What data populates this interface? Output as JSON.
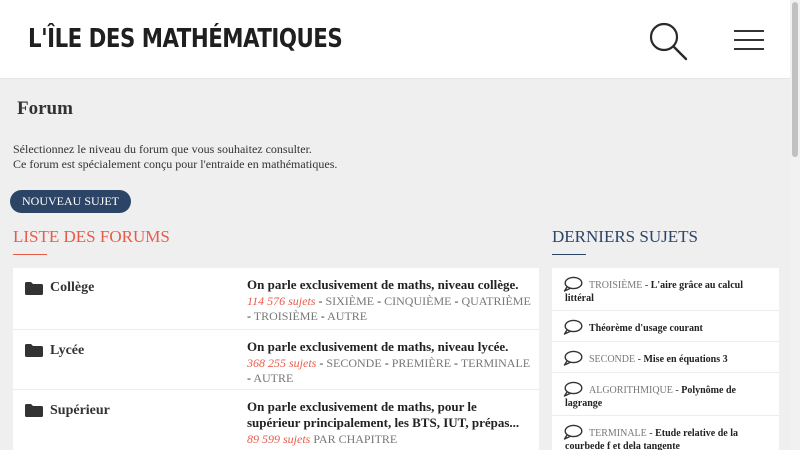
{
  "header": {
    "logo": "L'ÎLE DES MATHÉMATIQUES",
    "search_icon": "search-icon",
    "menu_icon": "hamburger-menu-icon"
  },
  "page": {
    "title": "Forum",
    "intro_line1": "Sélectionnez le niveau du forum que vous souhaitez consulter.",
    "intro_line2": "Ce forum est spécialement conçu pour l'entraide en mathématiques.",
    "new_topic_label": "Nouveau sujet"
  },
  "forums": {
    "heading": "Liste des forums",
    "items": [
      {
        "name": "Collège",
        "desc": "On parle exclusivement de maths, niveau collège.",
        "count": "114 576 sujets",
        "subs": [
          "SIXIÈME",
          "CINQUIÈME",
          "QUATRIÈME",
          "TROISIÈME",
          "AUTRE"
        ]
      },
      {
        "name": "Lycée",
        "desc": "On parle exclusivement de maths, niveau lycée.",
        "count": "368 255 sujets",
        "subs": [
          "SECONDE",
          "PREMIÈRE",
          "TERMINALE",
          "AUTRE"
        ]
      },
      {
        "name": "Supérieur",
        "desc": "On parle exclusivement de maths, pour le supérieur principalement, les BTS, IUT, prépas...",
        "count": "89 599 sujets",
        "subs": [
          "PAR CHAPITRE"
        ]
      }
    ]
  },
  "latest": {
    "heading": "Derniers sujets",
    "items": [
      {
        "category": "TROISIÈME",
        "sep": " - ",
        "title": "L'aire grâce au calcul littéral"
      },
      {
        "category": "",
        "sep": "",
        "title": "Théorème d'usage courant"
      },
      {
        "category": "SECONDE",
        "sep": " - ",
        "title": "Mise en équations 3"
      },
      {
        "category": "ALGORITHMIQUE",
        "sep": " - ",
        "title": "Polynôme de lagrange"
      },
      {
        "category": "TERMINALE",
        "sep": " - ",
        "title": "Etude relative de la courbede f et dela tangente"
      }
    ]
  },
  "colors": {
    "accent_red": "#e85b4a",
    "accent_navy": "#2c4466",
    "background": "#efefef"
  }
}
